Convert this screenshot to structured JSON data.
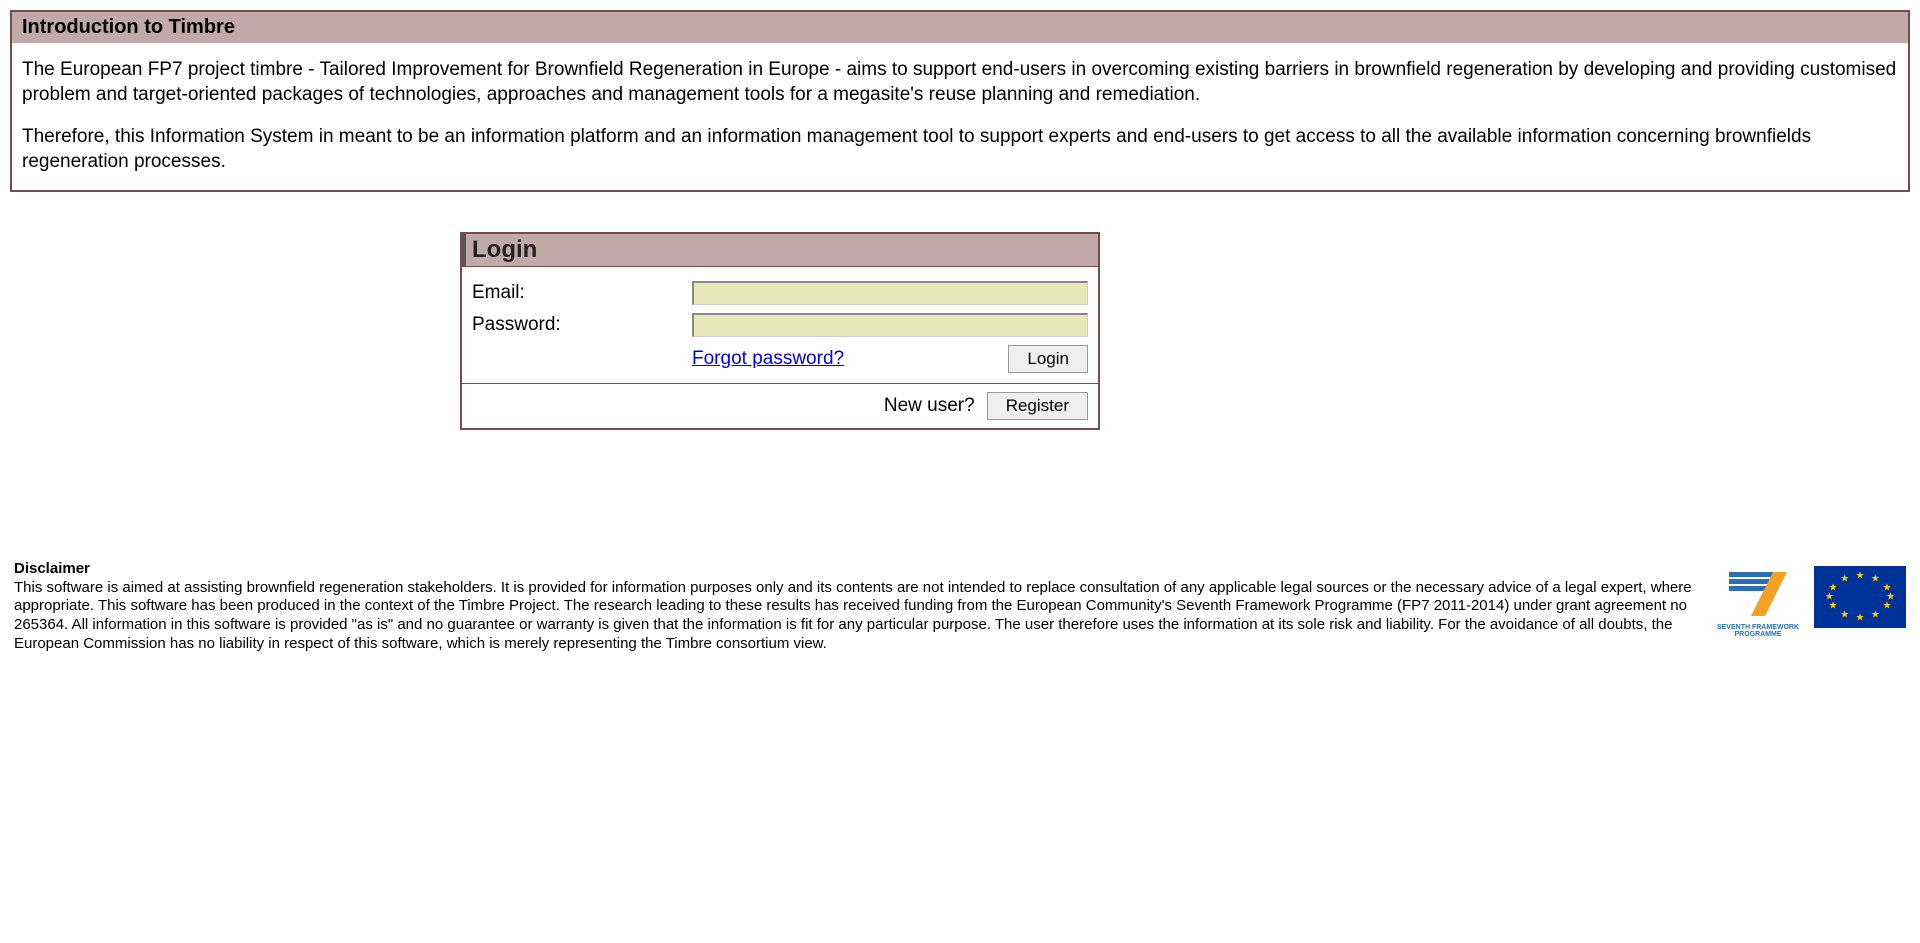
{
  "intro": {
    "title": "Introduction to Timbre",
    "para1": "The European FP7 project timbre - Tailored Improvement for Brownfield Regeneration in Europe - aims to support end-users in overcoming existing barriers in brownfield regeneration by developing and providing customised problem and target-oriented packages of technologies, approaches and management tools for a megasite's reuse planning and remediation.",
    "para2": "Therefore, this Information System in meant to be an information platform and an information management tool to support experts and end-users to get access to all the available information concerning brownfields regeneration processes."
  },
  "login": {
    "title": "Login",
    "email_label": "Email:",
    "password_label": "Password:",
    "email_value": "",
    "password_value": "",
    "forgot_text": "Forgot password?",
    "login_button": "Login",
    "newuser_text": "New user?",
    "register_button": "Register"
  },
  "footer": {
    "disclaimer_title": "Disclaimer",
    "disclaimer_text": "This software is aimed at assisting brownfield regeneration stakeholders. It is provided for information purposes only and its contents are not intended to replace consultation of any applicable legal sources or the necessary advice of a legal expert, where appropriate. This software has been produced in the context of the Timbre Project. The research leading to these results has received funding from the European Community's Seventh Framework Programme (FP7 2011-2014) under grant agreement no 265364. All information in this software is provided \"as is\" and no guarantee or warranty is given that the information is fit for any particular purpose. The user therefore uses the information at its sole risk and liability. For the avoidance of all doubts, the European Commission has no liability in respect of this software, which is merely representing the Timbre consortium view.",
    "fp7_label": "SEVENTH FRAMEWORK PROGRAMME"
  }
}
